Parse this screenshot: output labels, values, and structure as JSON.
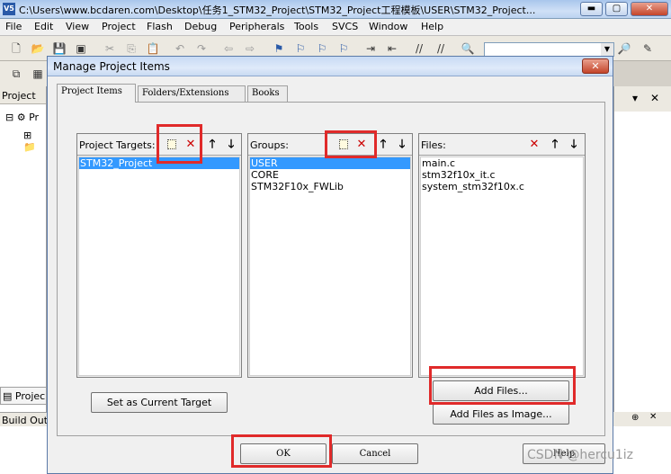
{
  "window": {
    "title": "C:\\Users\\www.bcdaren.com\\Desktop\\任务1_STM32_Project\\STM32_Project工程模板\\USER\\STM32_Project...",
    "app_icon": "V5",
    "minimize": "▬",
    "maximize": "▢",
    "close": "✕"
  },
  "menu": [
    "File",
    "Edit",
    "View",
    "Project",
    "Flash",
    "Debug",
    "Peripherals",
    "Tools",
    "SVCS",
    "Window",
    "Help"
  ],
  "project_pane": {
    "header": "Project",
    "tree_root": "Pr",
    "tab": "Projec"
  },
  "build_output": {
    "header": "Build Out"
  },
  "dialog": {
    "title": "Manage Project Items",
    "close": "✕",
    "tabs": [
      "Project Items",
      "Folders/Extensions",
      "Books"
    ],
    "targets": {
      "label": "Project Targets:",
      "items": [
        "STM32_Project"
      ],
      "selected": 0
    },
    "groups": {
      "label": "Groups:",
      "items": [
        "USER",
        "CORE",
        "STM32F10x_FWLib"
      ],
      "selected": 0
    },
    "files": {
      "label": "Files:",
      "items": [
        "main.c",
        "stm32f10x_it.c",
        "system_stm32f10x.c"
      ]
    },
    "set_current_target": "Set as Current Target",
    "add_files": "Add Files...",
    "add_files_as_image": "Add Files as Image...",
    "ok": "OK",
    "cancel": "Cancel",
    "help": "Help"
  },
  "watermark": "CSDN @hercu1iz",
  "icons": {
    "new": "new-item-icon",
    "delete": "delete-icon",
    "up": "move-up-icon",
    "down": "move-down-icon"
  }
}
